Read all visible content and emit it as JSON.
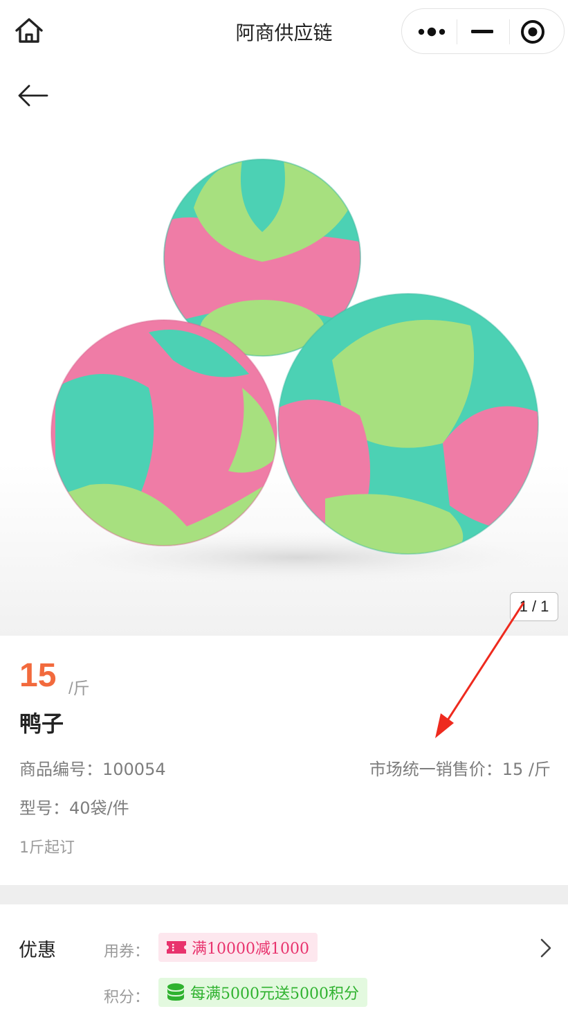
{
  "nav": {
    "title": "阿商供应链"
  },
  "gallery": {
    "pager": "1 / 1"
  },
  "product": {
    "price": "15",
    "unit": "/斤",
    "name": "鸭子",
    "code_label": "商品编号：",
    "code_value": "100054",
    "market_price_text": "市场统一销售价：15 /斤",
    "model_text": "型号：40袋/件",
    "moq_text": "1斤起订"
  },
  "promo": {
    "label": "优惠",
    "coupon_key": "用券：",
    "coupon_text": "满10000减1000",
    "points_key": "积分：",
    "points_text": "每满5000元送5000积分"
  },
  "colors": {
    "price": "#f26a3d",
    "coupon_fg": "#e8336d",
    "coupon_bg": "#fde7ee",
    "points_fg": "#2fb22f",
    "points_bg": "#e3f9df",
    "annotation_arrow": "#ee2a1e"
  },
  "icons": [
    "home-icon",
    "more-dots-icon",
    "minimize-icon",
    "target-icon",
    "back-arrow-icon",
    "coupon-ticket-icon",
    "coins-icon",
    "chevron-right-icon"
  ]
}
